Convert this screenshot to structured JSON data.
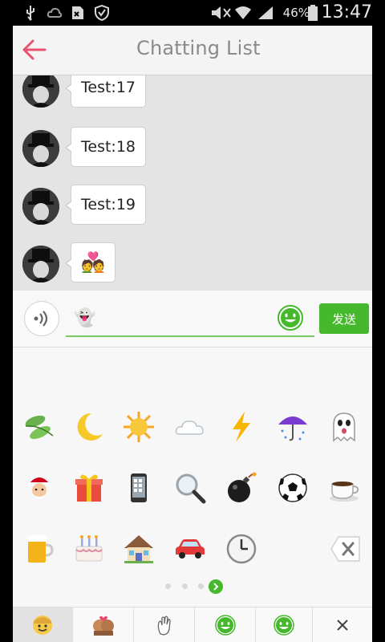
{
  "status_bar": {
    "battery_percent": "46%",
    "time": "13:47",
    "icons": [
      "usb-icon",
      "cloud-icon",
      "sim-icon",
      "shield-icon",
      "mute-icon",
      "wifi-icon",
      "signal-icon",
      "battery-icon"
    ]
  },
  "header": {
    "title": "Chatting List",
    "back_icon": "arrow-left-icon"
  },
  "messages": [
    {
      "text": "Test:17",
      "avatar": "top-hat-avatar"
    },
    {
      "text": "Test:18",
      "avatar": "top-hat-avatar"
    },
    {
      "text": "Test:19",
      "avatar": "top-hat-avatar"
    },
    {
      "text": "💑",
      "avatar": "top-hat-avatar"
    }
  ],
  "input_bar": {
    "voice_icon": "voice-icon",
    "input_value": "👻",
    "emoji_icon": "smile-icon",
    "send_label": "发送"
  },
  "emoji_grid": [
    [
      "leaves-icon",
      "moon-icon",
      "sun-icon",
      "cloud-icon",
      "lightning-icon",
      "umbrella-icon",
      "ghost-icon"
    ],
    [
      "santa-icon",
      "gift-icon",
      "phone-icon",
      "magnifier-icon",
      "bomb-icon",
      "soccer-ball-icon",
      "coffee-icon"
    ],
    [
      "beer-icon",
      "cake-icon",
      "house-icon",
      "car-icon",
      "clock-icon"
    ]
  ],
  "delete_icon": "backspace-icon",
  "pager": {
    "pages": 4,
    "current": 4
  },
  "bottom_tabs": [
    {
      "icon": "smiley-tab-icon",
      "selected": true
    },
    {
      "icon": "couple-tab-icon",
      "selected": false
    },
    {
      "icon": "wave-tab-icon",
      "selected": false
    },
    {
      "icon": "green-smile-tab-icon",
      "selected": false
    },
    {
      "icon": "green-smile-tab-icon-2",
      "selected": false
    },
    {
      "icon": "close-icon",
      "selected": false
    }
  ],
  "colors": {
    "accent_green": "#45b82b",
    "back_arrow": "#e8546f",
    "title": "#8a8a8a"
  }
}
